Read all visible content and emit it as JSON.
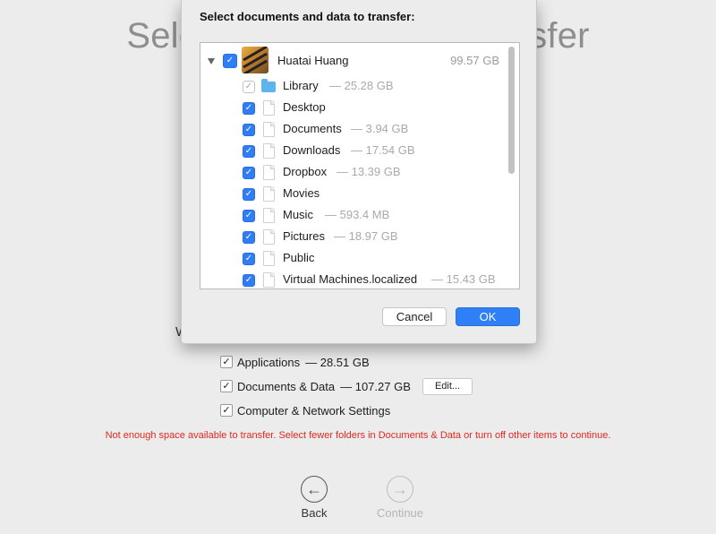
{
  "background": {
    "title": "Select information to transfer",
    "partial_letter": "W",
    "options": [
      {
        "label": "Applications",
        "size": "— 28.51 GB",
        "checked": true
      },
      {
        "label": "Documents & Data",
        "size": "— 107.27 GB",
        "checked": true
      },
      {
        "label": "Computer & Network Settings",
        "size": "",
        "checked": true
      }
    ],
    "edit_label": "Edit...",
    "warning": "Not enough space available to transfer. Select fewer folders in Documents & Data or turn off other items to continue.",
    "back_label": "Back",
    "continue_label": "Continue"
  },
  "sheet": {
    "title": "Select documents and data to transfer:",
    "root": {
      "name": "Huatai Huang",
      "size": "99.57 GB",
      "checked": true
    },
    "items": [
      {
        "name": "Library",
        "size": "— 25.28 GB",
        "icon": "folder-icon",
        "checked": true,
        "dimmed": true
      },
      {
        "name": "Desktop",
        "size": "",
        "icon": "document-icon",
        "checked": true
      },
      {
        "name": "Documents",
        "size": "— 3.94 GB",
        "icon": "document-icon",
        "checked": true
      },
      {
        "name": "Downloads",
        "size": "— 17.54 GB",
        "icon": "document-icon",
        "checked": true
      },
      {
        "name": "Dropbox",
        "size": "— 13.39 GB",
        "icon": "document-icon",
        "checked": true
      },
      {
        "name": "Movies",
        "size": "",
        "icon": "document-icon",
        "checked": true
      },
      {
        "name": "Music",
        "size": "— 593.4 MB",
        "icon": "document-icon",
        "checked": true
      },
      {
        "name": "Pictures",
        "size": "— 18.97 GB",
        "icon": "document-icon",
        "checked": true
      },
      {
        "name": "Public",
        "size": "",
        "icon": "document-icon",
        "checked": true
      },
      {
        "name": "Virtual Machines.localized",
        "size": "— 15.43 GB",
        "icon": "document-icon",
        "checked": true
      }
    ],
    "cancel_label": "Cancel",
    "ok_label": "OK"
  },
  "colors": {
    "accent": "#2f80f7",
    "warning": "#e0281f"
  }
}
